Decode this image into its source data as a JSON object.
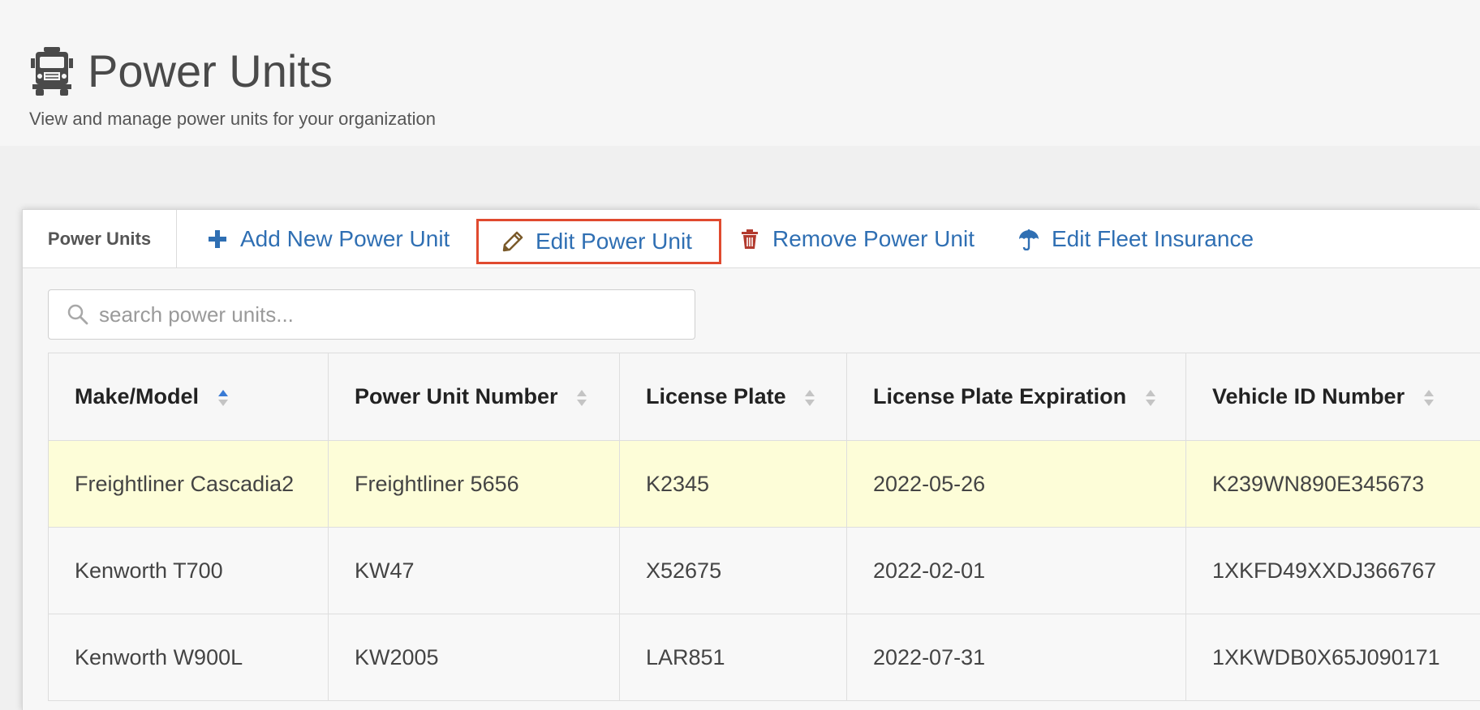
{
  "header": {
    "title": "Power Units",
    "subtitle": "View and manage power units for your organization",
    "icon": "truck-icon"
  },
  "toolbar": {
    "heading": "Power Units",
    "add_label": "Add New Power Unit",
    "edit_label": "Edit Power Unit",
    "remove_label": "Remove Power Unit",
    "fleet_label": "Edit Fleet Insurance",
    "accent_color": "#2f6fb3",
    "highlight_color": "#e04a2f"
  },
  "search": {
    "placeholder": "search power units...",
    "value": ""
  },
  "table": {
    "columns": [
      {
        "label": "Make/Model",
        "sort": "asc"
      },
      {
        "label": "Power Unit Number",
        "sort": "none"
      },
      {
        "label": "License Plate",
        "sort": "none"
      },
      {
        "label": "License Plate Expiration",
        "sort": "none"
      },
      {
        "label": "Vehicle ID Number",
        "sort": "none"
      }
    ],
    "rows": [
      {
        "make_model": "Freightliner Cascadia2",
        "unit_number": "Freightliner 5656",
        "plate": "K2345",
        "expiration": "2022-05-26",
        "vin": "K239WN890E345673",
        "selected": true
      },
      {
        "make_model": "Kenworth T700",
        "unit_number": "KW47",
        "plate": "X52675",
        "expiration": "2022-02-01",
        "vin": "1XKFD49XXDJ366767",
        "selected": false
      },
      {
        "make_model": "Kenworth W900L",
        "unit_number": "KW2005",
        "plate": "LAR851",
        "expiration": "2022-07-31",
        "vin": "1XKWDB0X65J090171",
        "selected": false
      }
    ],
    "selected_row_color": "#fdfdd8"
  }
}
